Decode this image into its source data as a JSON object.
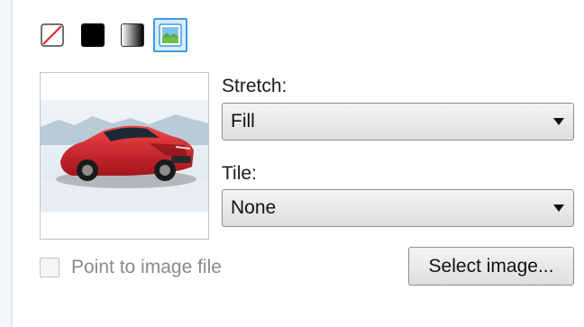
{
  "brush_types": {
    "items": [
      {
        "id": "none",
        "icon": "no-brush-icon",
        "selected": false
      },
      {
        "id": "solid",
        "icon": "solid-color-icon",
        "selected": false
      },
      {
        "id": "gradient",
        "icon": "gradient-icon",
        "selected": false
      },
      {
        "id": "image",
        "icon": "image-brush-icon",
        "selected": true
      }
    ]
  },
  "preview": {
    "icon": "car-image-preview"
  },
  "stretch": {
    "label": "Stretch:",
    "value": "Fill"
  },
  "tile": {
    "label": "Tile:",
    "value": "None"
  },
  "point_to_file": {
    "label": "Point to image file",
    "checked": false
  },
  "select_image": {
    "label": "Select image..."
  },
  "colors": {
    "accent": "#3c9ae8",
    "selection_bg": "#dcebfb",
    "car_red": "#d8232a"
  }
}
